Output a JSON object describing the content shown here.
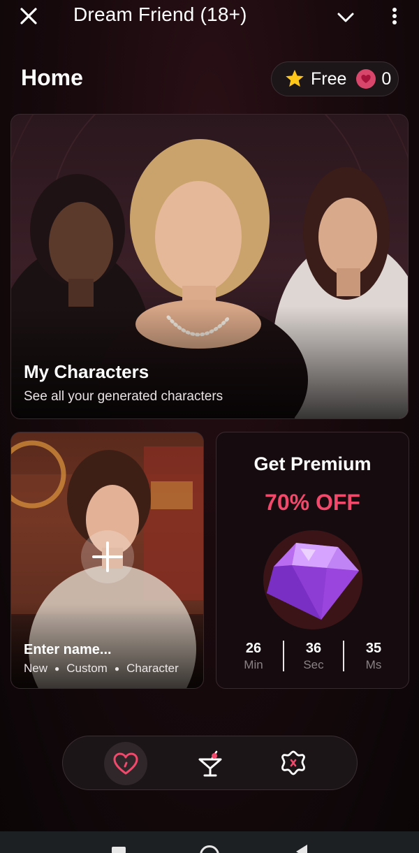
{
  "app": {
    "title": "Dream Friend (18+)",
    "icons": {
      "close": "close-icon",
      "dropdown": "chevron-down-icon",
      "menu": "more-vertical-icon"
    }
  },
  "header": {
    "title": "Home",
    "plan_label": "Free",
    "hearts_count": "0",
    "icons": {
      "plan": "star-icon",
      "hearts": "heart-icon"
    }
  },
  "hero": {
    "title": "My Characters",
    "subtitle": "See all your generated characters"
  },
  "new_character": {
    "name_placeholder": "Enter name...",
    "tags": [
      "New",
      "Custom",
      "Character"
    ],
    "icon": "plus-icon"
  },
  "premium": {
    "title": "Get Premium",
    "discount": "70% OFF",
    "icon": "diamond-gem-icon",
    "accent": "#f0496b",
    "timer": [
      {
        "value": "26",
        "unit": "Min"
      },
      {
        "value": "36",
        "unit": "Sec"
      },
      {
        "value": "35",
        "unit": "Ms"
      }
    ]
  },
  "bottom_nav": {
    "items": [
      {
        "icon": "heart-icon",
        "active": true
      },
      {
        "icon": "cocktail-icon",
        "active": false
      },
      {
        "icon": "settings-icon",
        "active": false
      }
    ],
    "accent": "#f0496b"
  }
}
